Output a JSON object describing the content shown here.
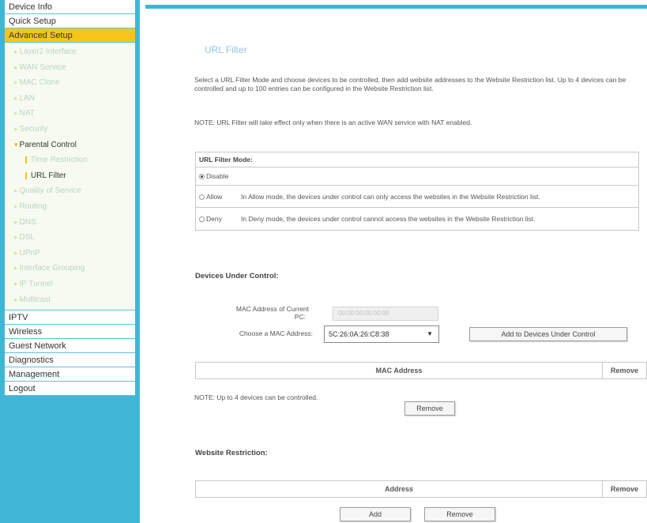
{
  "sidebar": {
    "top_items": [
      {
        "label": "Device Info"
      },
      {
        "label": "Quick Setup"
      }
    ],
    "active_section": "Advanced Setup",
    "sub_items_a": [
      {
        "label": "Layer2 Interface"
      },
      {
        "label": "WAN Service"
      },
      {
        "label": "MAC Clone"
      },
      {
        "label": "LAN"
      },
      {
        "label": "NAT"
      },
      {
        "label": "Security"
      }
    ],
    "parental_control": "Parental Control",
    "time_restriction": "Time Restriction",
    "url_filter": "URL Filter",
    "sub_items_b": [
      {
        "label": "Quality of Service"
      },
      {
        "label": "Routing"
      },
      {
        "label": "DNS"
      },
      {
        "label": "DSL"
      },
      {
        "label": "UPnP"
      },
      {
        "label": "Interface Grouping"
      },
      {
        "label": "IP Tunnel"
      },
      {
        "label": "Multicast"
      }
    ],
    "bottom_items": [
      {
        "label": "IPTV"
      },
      {
        "label": "Wireless"
      },
      {
        "label": "Guest Network"
      },
      {
        "label": "Diagnostics"
      },
      {
        "label": "Management"
      },
      {
        "label": "Logout"
      }
    ]
  },
  "page": {
    "title": "URL Filter",
    "description": "Select a URL Filter Mode and choose devices to be controlled, then add website addresses to the Website Restriction list. Up to 4 devices can be controlled and up to 100 entries can be configured in the Website Restriction list.",
    "note_wan": "NOTE: URL Filter will take effect only when there is an active WAN service with NAT enabled."
  },
  "mode": {
    "header": "URL Filter Mode:",
    "selected": "Disable",
    "disable_label": "Disable",
    "allow_label": "Allow",
    "allow_desc": "In Allow mode, the devices under control can only access the websites in the Website Restriction list.",
    "deny_label": "Deny",
    "deny_desc": "In Deny mode, the devices under control cannot access the websites in the Website Restriction list."
  },
  "devices": {
    "title": "Devices Under Control:",
    "current_pc_label_1": "MAC Address of Current",
    "current_pc_label_2": "PC:",
    "current_pc_value": "00:00:00:00:00:00",
    "choose_label": "Choose a MAC Address:",
    "selected_mac": "5C:26:0A:26:C8:38",
    "add_button": "Add to Devices Under Control",
    "table_col_mac": "MAC Address",
    "table_col_remove": "Remove",
    "note": "NOTE: Up to 4 devices can be controlled.",
    "remove_button": "Remove"
  },
  "website": {
    "title": "Website Restriction:",
    "table_col_address": "Address",
    "table_col_remove": "Remove",
    "add_button": "Add",
    "remove_button": "Remove"
  },
  "colors": {
    "sidebar_bg": "#3fb6d6",
    "active_item": "#f5c617"
  }
}
